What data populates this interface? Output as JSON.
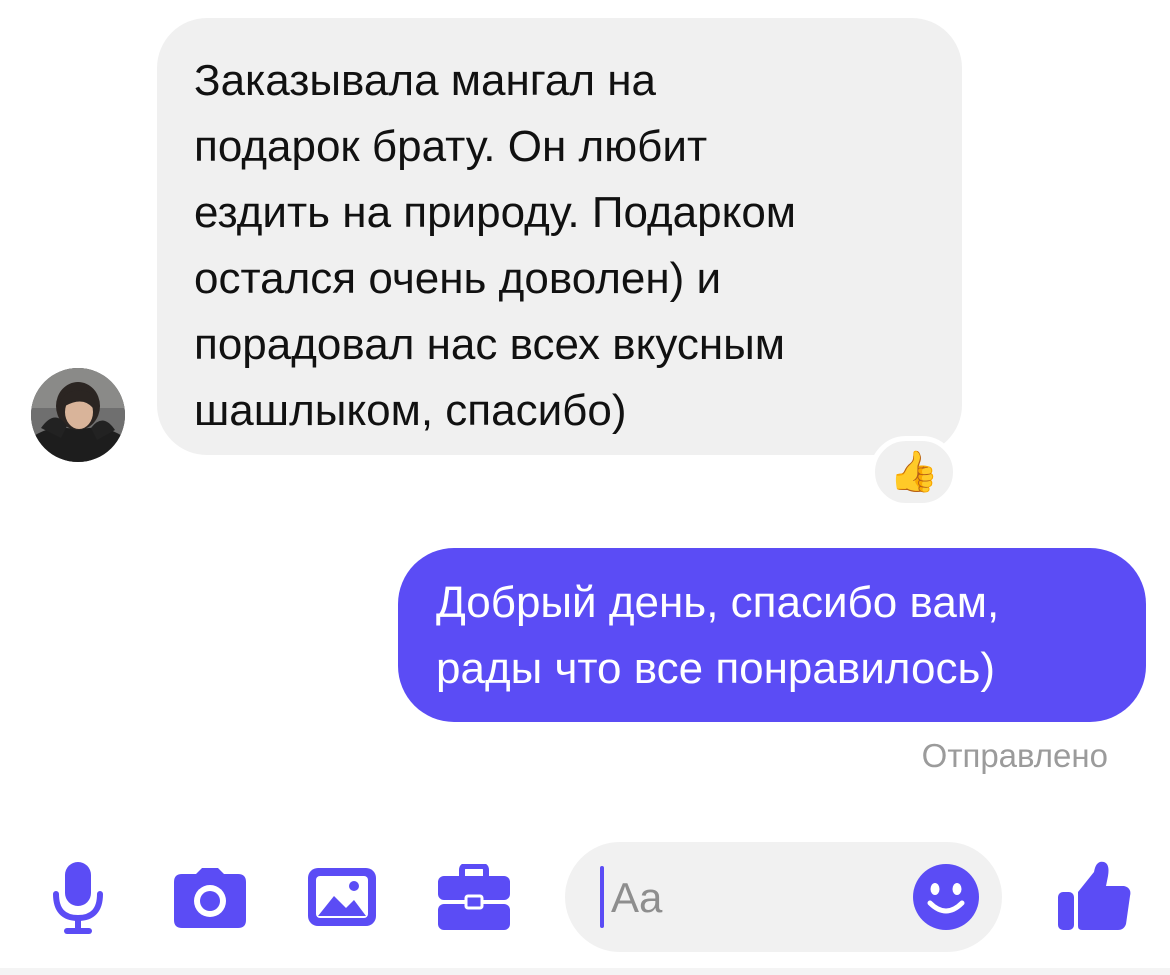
{
  "conversation": {
    "incoming_message": {
      "text": "Заказывала мангал на\nподарок брату. Он любит\nездить на природу. Подарком\nостался очень доволен) и\nпорадовал нас всех вкусным\nшашлыком, спасибо)",
      "reaction": "👍"
    },
    "outgoing_message": {
      "text": "Добрый день, спасибо вам,\nрады что все понравилось)",
      "status": "Отправлено"
    }
  },
  "composer": {
    "placeholder": "Aa"
  },
  "toolbar": {
    "icons": [
      "microphone-icon",
      "camera-icon",
      "gallery-icon",
      "briefcase-icon",
      "emoji-icon",
      "thumbs-up-icon"
    ]
  },
  "colors": {
    "accent": "#5b4cf5",
    "incoming_bubble": "#f0f0f0",
    "status_text": "#9b9b9b"
  }
}
